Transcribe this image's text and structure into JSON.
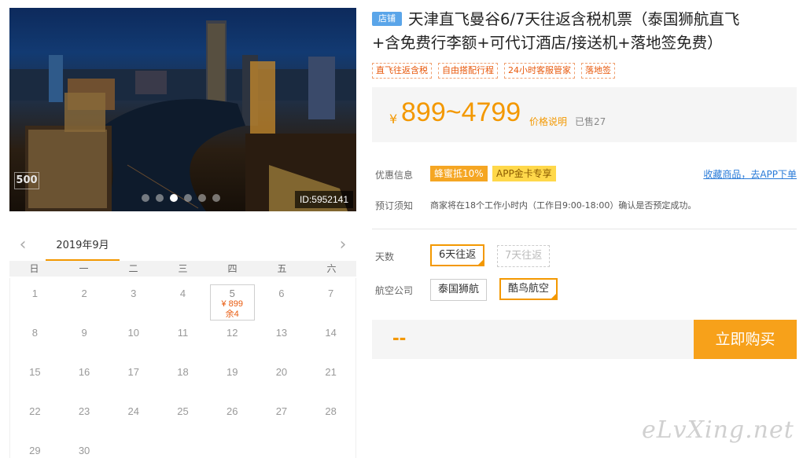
{
  "photo": {
    "id_label": "ID:5952141",
    "logo_text": "500",
    "carousel_dots": 6,
    "active_dot": 3
  },
  "calendar": {
    "month": "2019年9月",
    "prev_glyph": "‹",
    "next_glyph": "›",
    "weekdays": [
      "日",
      "一",
      "二",
      "三",
      "四",
      "五",
      "六"
    ],
    "days": [
      {
        "d": "1"
      },
      {
        "d": "2"
      },
      {
        "d": "3"
      },
      {
        "d": "4"
      },
      {
        "d": "5",
        "price": "¥ 899",
        "remain": "余4"
      },
      {
        "d": "6"
      },
      {
        "d": "7"
      },
      {
        "d": "8"
      },
      {
        "d": "9"
      },
      {
        "d": "10"
      },
      {
        "d": "11"
      },
      {
        "d": "12"
      },
      {
        "d": "13"
      },
      {
        "d": "14"
      },
      {
        "d": "15"
      },
      {
        "d": "16"
      },
      {
        "d": "17"
      },
      {
        "d": "18"
      },
      {
        "d": "19"
      },
      {
        "d": "20"
      },
      {
        "d": "21"
      },
      {
        "d": "22"
      },
      {
        "d": "23"
      },
      {
        "d": "24"
      },
      {
        "d": "25"
      },
      {
        "d": "26"
      },
      {
        "d": "27"
      },
      {
        "d": "28"
      },
      {
        "d": "29"
      },
      {
        "d": "30"
      }
    ]
  },
  "product": {
    "store_badge": "店铺",
    "title_line1": "天津直飞曼谷6/7天往返含税机票（泰国狮航直飞",
    "title_line2": "+含免费行李额+可代订酒店/接送机+落地签免费）",
    "tags": [
      "直飞往返含税",
      "自由搭配行程",
      "24小时客服管家",
      "落地签"
    ],
    "price_symbol": "¥",
    "price_range": "899~4799",
    "price_note": "价格说明",
    "sold": "已售27"
  },
  "promo": {
    "label": "优惠信息",
    "tag_a": "蜂蜜抵10%",
    "tag_b": "APP金卡专享",
    "fav_link": "收藏商品，去APP下单"
  },
  "booking": {
    "label": "预订须知",
    "notice": "商家将在18个工作小时内（工作日9:00-18:00）确认是否预定成功。"
  },
  "options": {
    "days_label": "天数",
    "days": [
      "6天往返",
      "7天往返"
    ],
    "airline_label": "航空公司",
    "airlines": [
      "泰国狮航",
      "酷鸟航空"
    ]
  },
  "buy": {
    "total": "--",
    "button": "立即购买"
  },
  "watermark": "eLvXing.net",
  "colors": {
    "accent": "#f39800",
    "price_red": "#e8590c",
    "link": "#2a7bd8",
    "store_blue": "#5aa5e9"
  }
}
